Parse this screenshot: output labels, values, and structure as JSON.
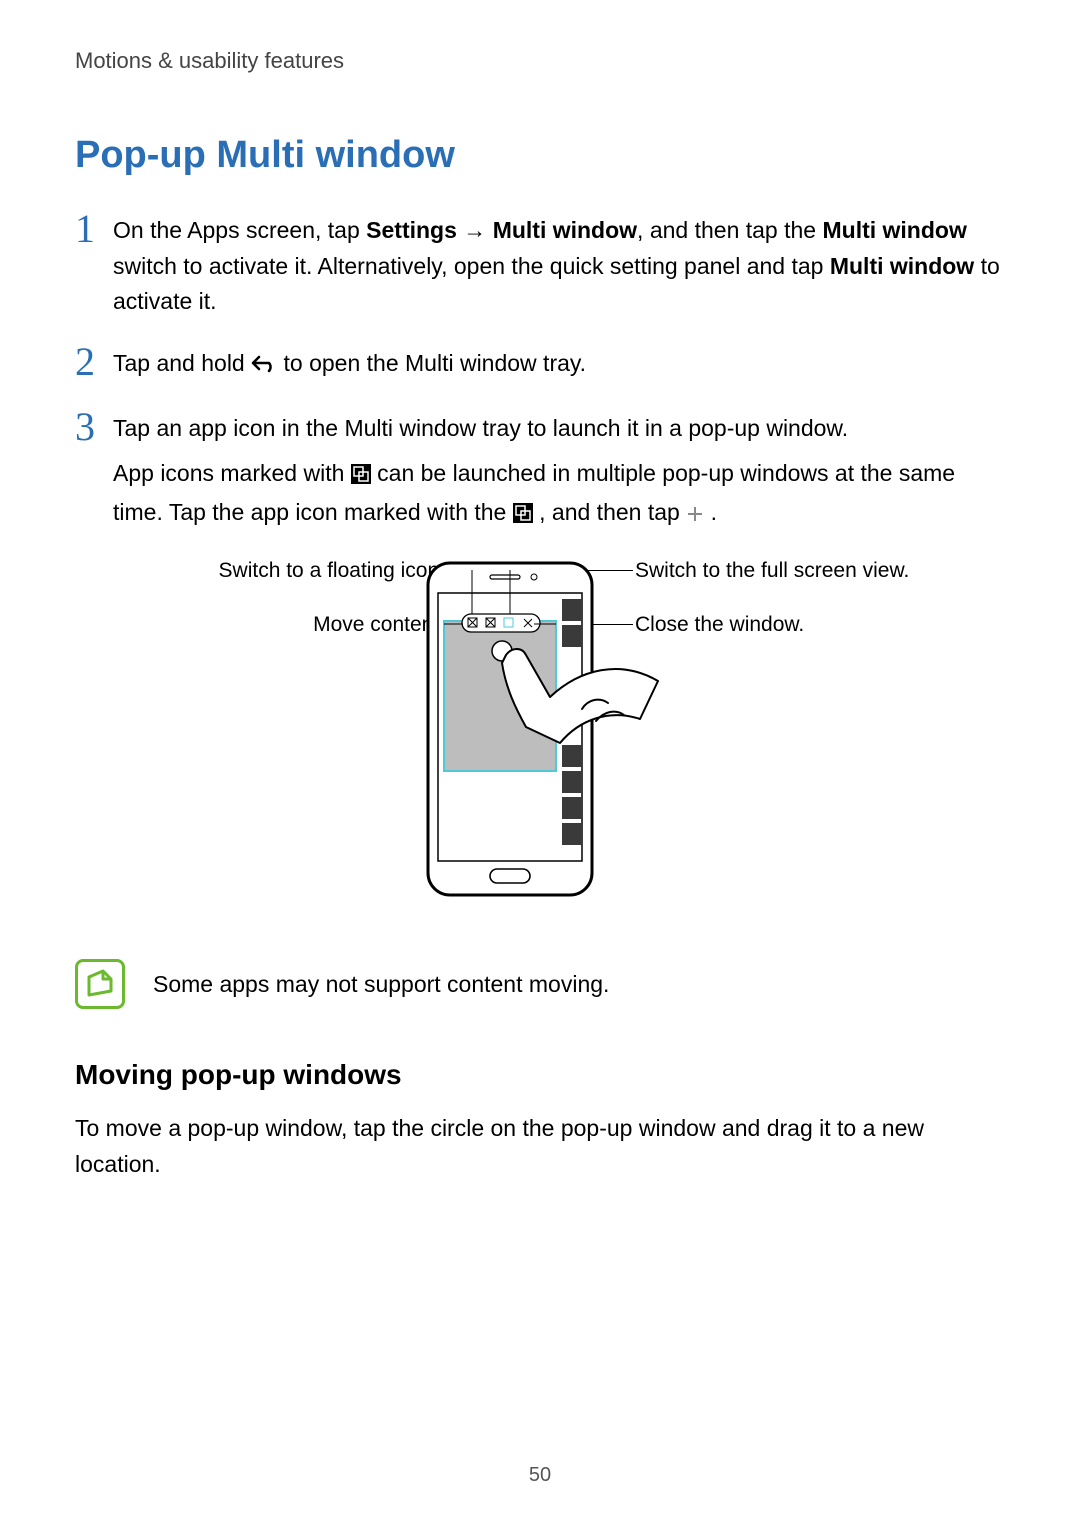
{
  "breadcrumb": "Motions & usability features",
  "title": "Pop-up Multi window",
  "steps": [
    {
      "num": "1",
      "html": "On the Apps screen, tap <b>Settings</b> → <b>Multi window</b>, and then tap the <b>Multi window</b> switch to activate it. Alternatively, open the quick setting panel and tap <b>Multi window</b> to activate it."
    },
    {
      "num": "2",
      "pre": "Tap and hold ",
      "post": " to open the Multi window tray."
    },
    {
      "num": "3",
      "line1": "Tap an app icon in the Multi window tray to launch it in a pop-up window.",
      "line2a": "App icons marked with ",
      "line2b": " can be launched in multiple pop-up windows at the same time. Tap the app icon marked with the ",
      "line2c": ", and then tap ",
      "line2d": "."
    }
  ],
  "callouts": {
    "topLeft": "Switch to a floating icon.",
    "topRight": "Switch to the full screen view.",
    "midLeft": "Move content.",
    "midRight": "Close the window."
  },
  "note": "Some apps may not support content moving.",
  "subTitle": "Moving pop-up windows",
  "subBody": "To move a pop-up window, tap the circle on the pop-up window and drag it to a new location.",
  "pageNum": "50"
}
